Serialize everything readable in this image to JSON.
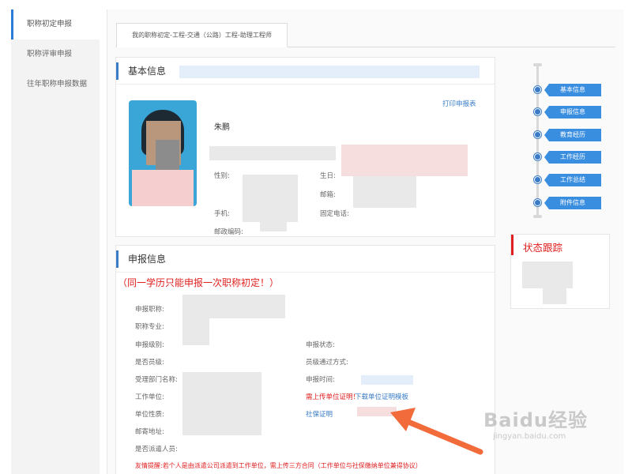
{
  "sidebar": {
    "items": [
      {
        "label": "职称初定申报",
        "active": true
      },
      {
        "label": "职称评审申报",
        "active": false
      },
      {
        "label": "往年职称申报数据",
        "active": false
      }
    ]
  },
  "tab": {
    "label": "我的职称初定-工程-交通（公路）工程-助理工程师"
  },
  "basic_info": {
    "title": "基本信息",
    "print_link": "打印申报表",
    "name": "朱鹏",
    "labels": {
      "gender": "性别:",
      "birth": "生日:",
      "email": "邮箱:",
      "mobile": "手机:",
      "phone": "固定电话:",
      "postcode": "邮政编码:"
    }
  },
  "apply_info": {
    "title": "申报信息",
    "warning": "（同一学历只能申报一次职称初定！）",
    "labels": {
      "title_applied": "申报职称:",
      "major": "职称专业:",
      "level": "申报级别:",
      "status": "申报状态:",
      "is_staff": "是否员级:",
      "staff_method": "员级通过方式:",
      "dept": "受理部门名称:",
      "time": "申报时间:",
      "employer": "工作单位:",
      "unit_nature": "单位性质:",
      "address": "邮寄地址:",
      "dispatched": "是否派遣人员:"
    },
    "upload_required": "需上传单位证明！",
    "download_template": "下载单位证明模板",
    "social_security": "社保证明",
    "notice": "友情提醒:若个人是由派遣公司派遣到工作单位，需上传三方合同（工作单位与社保缴纳单位兼得协议）"
  },
  "steps": [
    {
      "label": "基本信息"
    },
    {
      "label": "申报信息"
    },
    {
      "label": "教育经历"
    },
    {
      "label": "工作经历"
    },
    {
      "label": "工作总结"
    },
    {
      "label": "附件信息"
    }
  ],
  "status_tracking": {
    "title": "状态跟踪"
  },
  "watermark": {
    "brand": "Baidu经验",
    "url": "jingyan.baidu.com"
  },
  "colors": {
    "accent": "#3a7cc7",
    "warning": "#e02020",
    "arrow": "#f26b3a"
  }
}
